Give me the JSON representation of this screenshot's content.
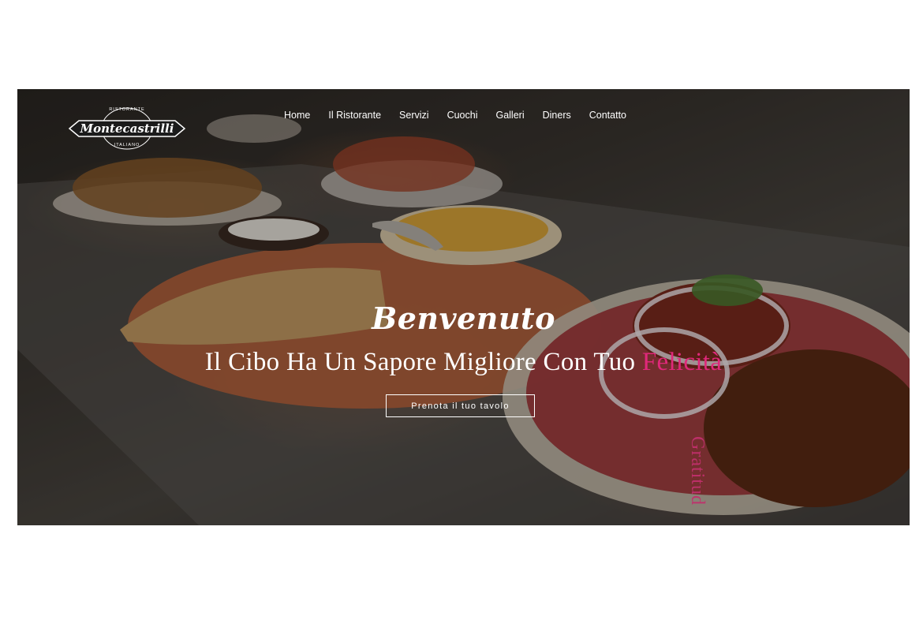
{
  "brand": {
    "name": "Montecastrilli",
    "badge_top": "RISTORANTE",
    "badge_bottom": "ITALIANO"
  },
  "nav": {
    "items": [
      {
        "label": "Home"
      },
      {
        "label": "Il Ristorante"
      },
      {
        "label": "Servizi"
      },
      {
        "label": "Cuochi"
      },
      {
        "label": "Galleri"
      },
      {
        "label": "Diners"
      },
      {
        "label": "Contatto"
      }
    ]
  },
  "hero": {
    "welcome": "Benvenuto",
    "tagline_main": "Il Cibo Ha Un Sapore Migliore Con Tuo ",
    "tagline_accent": "Felicità",
    "cta_label": "Prenota il tuo tavolo",
    "side_text": "Gratitud"
  },
  "colors": {
    "accent": "#e0287a",
    "text": "#ffffff"
  }
}
